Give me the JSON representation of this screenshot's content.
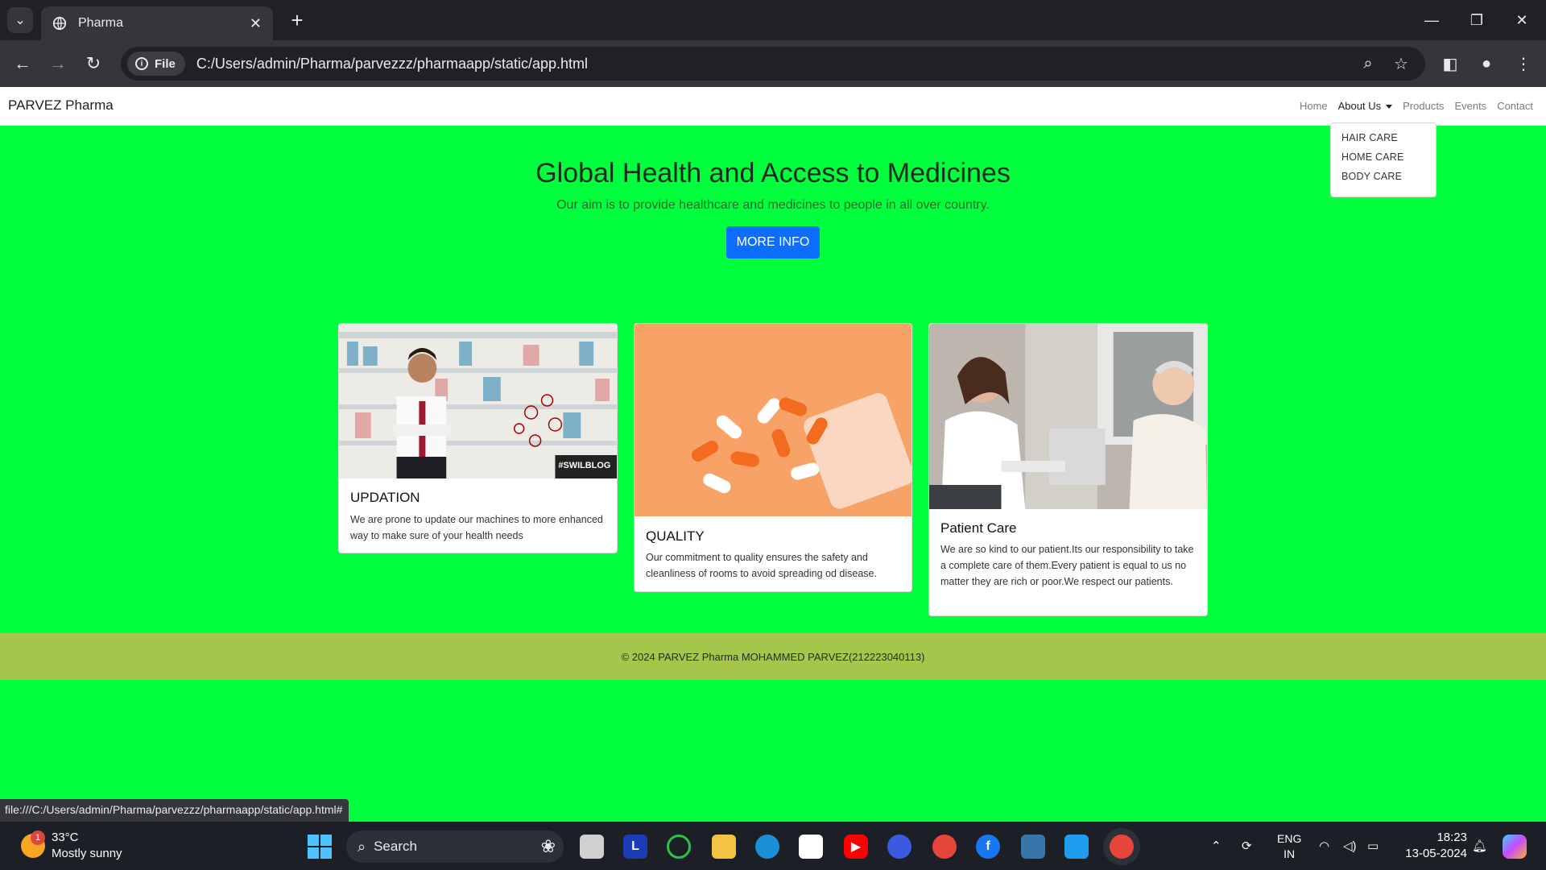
{
  "browser": {
    "tab_title": "Pharma",
    "url_chip": "File",
    "url": "C:/Users/admin/Pharma/parvezzz/pharmaapp/static/app.html",
    "status_url": "file:///C:/Users/admin/Pharma/parvezzz/pharmaapp/static/app.html#"
  },
  "site": {
    "brand": "PARVEZ Pharma",
    "nav": [
      "Home",
      "About Us",
      "Products",
      "Events",
      "Contact"
    ],
    "dropdown": [
      "HAIR CARE",
      "HOME CARE",
      "BODY CARE"
    ],
    "hero_title": "Global Health and Access to Medicines",
    "hero_subtitle": "Our aim is to provide healthcare and medicines to people in all over country.",
    "hero_button": "MORE INFO",
    "cards": [
      {
        "title": "UPDATION",
        "text": "We are prone to update our machines to more enhanced way to make sure of your health needs",
        "image_badge": "#SWILBLOG"
      },
      {
        "title": "QUALITY",
        "text": "Our commitment to quality ensures the safety and cleanliness of rooms to avoid spreading od disease."
      },
      {
        "title": "Patient Care",
        "text": "We are so kind to our patient.Its our responsibility to take a complete care of them.Every patient is equal to us no matter they are rich or poor.We respect our patients."
      }
    ],
    "footer": "© 2024 PARVEZ Pharma MOHAMMED PARVEZ(212223040113)",
    "page_background": "#00ff3d",
    "footer_background": "#a4c64a",
    "button_color": "#0d6efd"
  },
  "taskbar": {
    "weather_badge": "1",
    "temperature": "33°C",
    "weather_text": "Mostly sunny",
    "search_label": "Search",
    "lang_line1": "ENG",
    "lang_line2": "IN",
    "time": "18:23",
    "date": "13-05-2024",
    "apps": [
      "file-explorer-icon",
      "l-app-icon",
      "spinner-app-icon",
      "folder-icon",
      "edge-icon",
      "store-icon",
      "youtube-icon",
      "vpn-icon",
      "chrome-icon",
      "facebook-icon",
      "python-icon",
      "vscode-icon",
      "chrome-active-icon"
    ]
  }
}
